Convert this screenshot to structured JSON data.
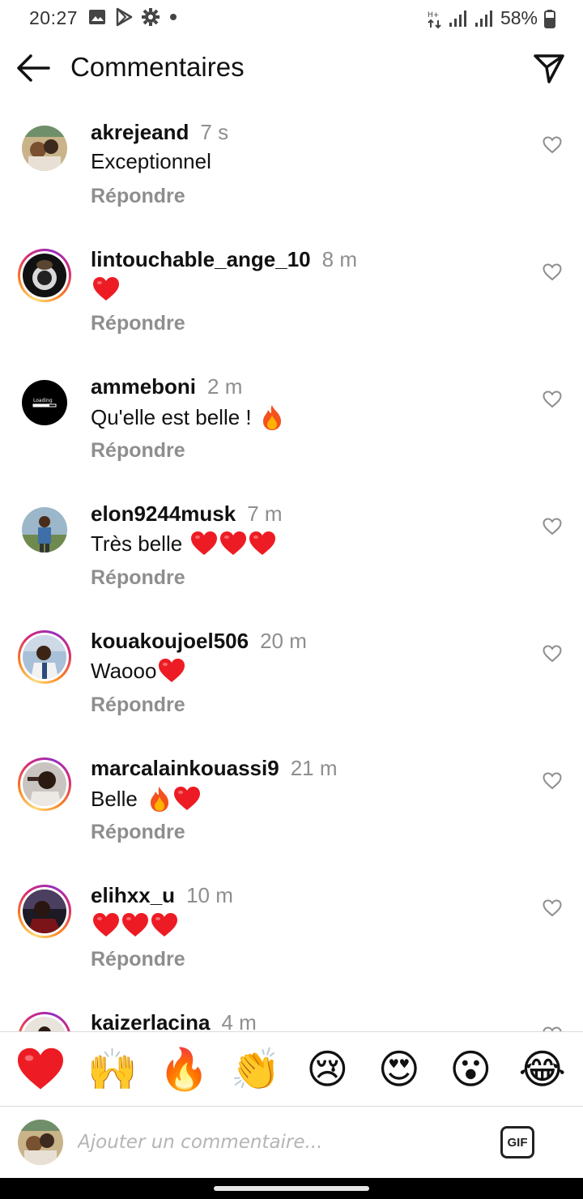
{
  "status_bar": {
    "time": "20:27",
    "battery": "58%",
    "icons": [
      "image-icon",
      "play-store-icon",
      "gear-icon",
      "dot-icon",
      "data-arrows-icon",
      "signal-icon",
      "signal-icon",
      "battery-icon"
    ]
  },
  "header": {
    "title": "Commentaires",
    "back_icon": "arrow-left-icon",
    "send_icon": "paper-plane-icon"
  },
  "comments": [
    {
      "username": "akrejeand",
      "time": "7 s",
      "text": "Exceptionnel",
      "reply": "Répondre",
      "emoji": []
    },
    {
      "username": "lintouchable_ange_10",
      "time": "8 m",
      "text": "",
      "reply": "Répondre",
      "emoji": [
        "heart"
      ]
    },
    {
      "username": "ammeboni",
      "time": "2 m",
      "text": "Qu'elle est belle !",
      "reply": "Répondre",
      "emoji": [
        "fire"
      ]
    },
    {
      "username": "elon9244musk",
      "time": "7 m",
      "text": "Très belle",
      "reply": "Répondre",
      "emoji": [
        "heart",
        "heart",
        "heart"
      ]
    },
    {
      "username": "kouakoujoel506",
      "time": "20 m",
      "text": "Waooo",
      "reply": "Répondre",
      "emoji": [
        "heart"
      ]
    },
    {
      "username": "marcalainkouassi9",
      "time": "21 m",
      "text": "Belle",
      "reply": "Répondre",
      "emoji": [
        "fire",
        "heart"
      ]
    },
    {
      "username": "elihxx_u",
      "time": "10 m",
      "text": "",
      "reply": "Répondre",
      "emoji": [
        "heart",
        "heart",
        "heart"
      ]
    },
    {
      "username": "kaizerlacina",
      "time": "4 m",
      "text": "",
      "reply": "",
      "emoji": []
    }
  ],
  "emoji_bar": [
    "❤️",
    "🙌",
    "🔥",
    "👏",
    "😢",
    "😍",
    "😮",
    "😂"
  ],
  "input": {
    "placeholder": "Ajouter un commentaire...",
    "gif_label": "GIF"
  },
  "colors": {
    "text": "#111111",
    "muted": "#8e8e8e",
    "heart": "#ed1c24",
    "story_ring": "#d62976"
  }
}
